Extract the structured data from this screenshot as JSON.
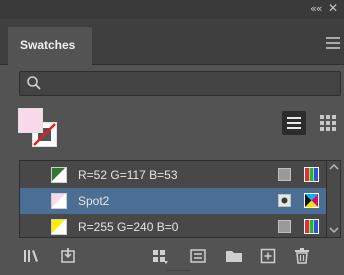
{
  "window": {
    "collapse_glyph": "««",
    "close_glyph": "✕"
  },
  "tab": {
    "label": "Swatches"
  },
  "search": {
    "placeholder": "",
    "value": ""
  },
  "fill": {
    "color": "#f9d9ea"
  },
  "stroke": {
    "color": "none"
  },
  "view": {
    "active": "list-view"
  },
  "swatches": [
    {
      "name": "R=52 G=117 B=53",
      "color": "#347535",
      "type": "process",
      "mode": "rgb",
      "selected": false
    },
    {
      "name": "Spot2",
      "color": "#f9d9ea",
      "type": "spot",
      "mode": "cmyk",
      "selected": true
    },
    {
      "name": "R=255 G=240 B=0",
      "color": "#fff000",
      "type": "process",
      "mode": "rgb",
      "selected": false
    }
  ],
  "bottom_toolbar": [
    "swatch-libraries-menu",
    "place-swatches-into-libraries",
    "show-swatch-kinds-menu",
    "swatch-options",
    "new-color-group",
    "new-swatch",
    "delete-swatch"
  ]
}
